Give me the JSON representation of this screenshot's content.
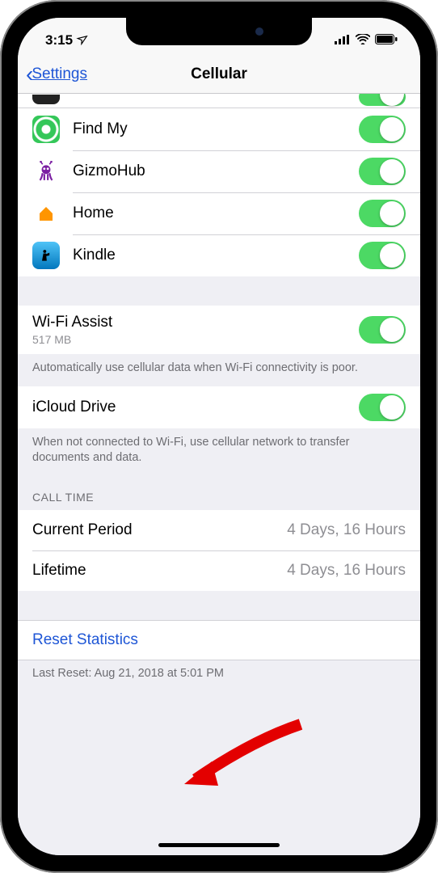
{
  "status": {
    "time": "3:15",
    "location_indicator": "➤"
  },
  "nav": {
    "back_label": "Settings",
    "title": "Cellular"
  },
  "apps": [
    {
      "id": "cutoff",
      "label": "",
      "icon": "cut",
      "toggle": true
    },
    {
      "id": "findmy",
      "label": "Find My",
      "icon": "findmy",
      "toggle": true
    },
    {
      "id": "gizmo",
      "label": "GizmoHub",
      "icon": "gizmo",
      "toggle": true
    },
    {
      "id": "home",
      "label": "Home",
      "icon": "home",
      "toggle": true
    },
    {
      "id": "kindle",
      "label": "Kindle",
      "icon": "kindle",
      "toggle": true
    }
  ],
  "wifi_assist": {
    "title": "Wi-Fi Assist",
    "sub": "517 MB",
    "footer": "Automatically use cellular data when Wi-Fi connectivity is poor.",
    "toggle": true
  },
  "icloud_drive": {
    "title": "iCloud Drive",
    "footer": "When not connected to Wi-Fi, use cellular network to transfer documents and data.",
    "toggle": true
  },
  "call_time": {
    "header": "CALL TIME",
    "rows": [
      {
        "label": "Current Period",
        "value": "4 Days, 16 Hours"
      },
      {
        "label": "Lifetime",
        "value": "4 Days, 16 Hours"
      }
    ]
  },
  "reset": {
    "label": "Reset Statistics",
    "last_reset": "Last Reset: Aug 21, 2018 at 5:01 PM"
  }
}
